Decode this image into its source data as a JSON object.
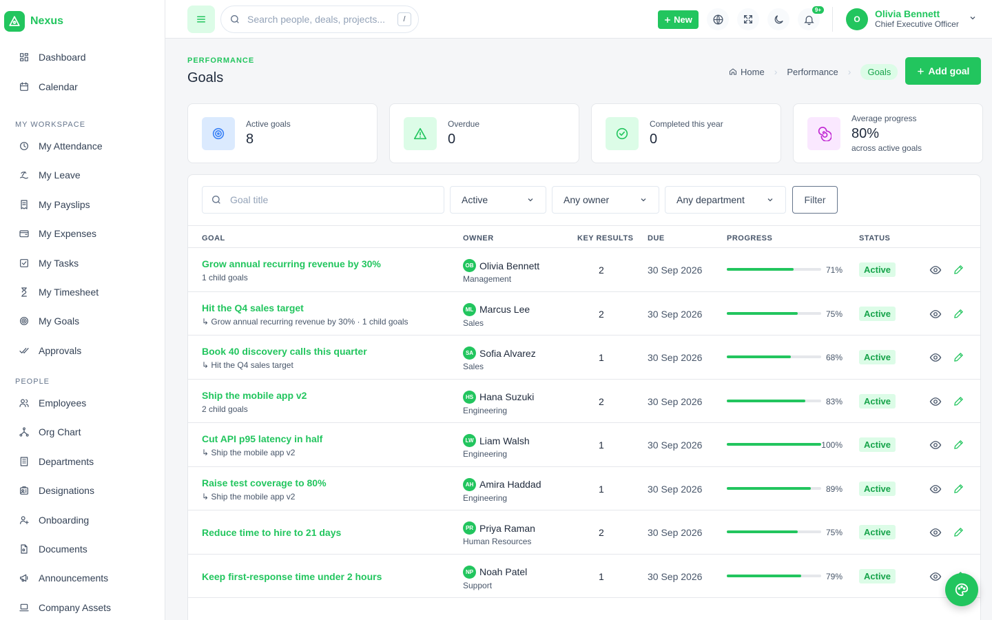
{
  "brand": {
    "name": "Nexus"
  },
  "sidebar": {
    "top": [
      {
        "label": "Dashboard",
        "icon": "dashboard-icon"
      },
      {
        "label": "Calendar",
        "icon": "calendar-icon"
      }
    ],
    "workspace_label": "MY WORKSPACE",
    "workspace": [
      {
        "label": "My Attendance",
        "icon": "clock-icon"
      },
      {
        "label": "My Leave",
        "icon": "beach-icon"
      },
      {
        "label": "My Payslips",
        "icon": "receipt-icon"
      },
      {
        "label": "My Expenses",
        "icon": "wallet-icon"
      },
      {
        "label": "My Tasks",
        "icon": "checkbox-icon"
      },
      {
        "label": "My Timesheet",
        "icon": "hourglass-icon"
      },
      {
        "label": "My Goals",
        "icon": "target-icon"
      },
      {
        "label": "Approvals",
        "icon": "double-check-icon"
      }
    ],
    "people_label": "PEOPLE",
    "people": [
      {
        "label": "Employees",
        "icon": "users-icon"
      },
      {
        "label": "Org Chart",
        "icon": "org-chart-icon"
      },
      {
        "label": "Departments",
        "icon": "building-icon"
      },
      {
        "label": "Designations",
        "icon": "id-badge-icon"
      },
      {
        "label": "Onboarding",
        "icon": "user-plus-icon"
      },
      {
        "label": "Documents",
        "icon": "document-icon"
      },
      {
        "label": "Announcements",
        "icon": "megaphone-icon"
      },
      {
        "label": "Company Assets",
        "icon": "laptop-icon"
      }
    ]
  },
  "topbar": {
    "search_placeholder": "Search people, deals, projects...",
    "search_shortcut": "/",
    "new_label": "New",
    "notif_badge": "9+",
    "user": {
      "initial": "O",
      "name": "Olivia Bennett",
      "role": "Chief Executive Officer"
    }
  },
  "page": {
    "eyebrow": "PERFORMANCE",
    "title": "Goals",
    "breadcrumb": [
      "Home",
      "Performance",
      "Goals"
    ],
    "add_label": "Add goal"
  },
  "stats": [
    {
      "label": "Active goals",
      "value": "8",
      "sub": "",
      "color": "#3b82f6",
      "bg": "#dbeafe",
      "icon": "target-icon"
    },
    {
      "label": "Overdue",
      "value": "0",
      "sub": "",
      "color": "#22c55e",
      "bg": "#dcfce7",
      "icon": "warning-icon"
    },
    {
      "label": "Completed this year",
      "value": "0",
      "sub": "",
      "color": "#22c55e",
      "bg": "#dcfce7",
      "icon": "check-circle-icon"
    },
    {
      "label": "Average progress",
      "value": "80%",
      "sub": "across active goals",
      "color": "#c026d3",
      "bg": "#fae8ff",
      "icon": "spiral-icon"
    }
  ],
  "filters": {
    "search_placeholder": "Goal title",
    "status": "Active",
    "owner": "Any owner",
    "department": "Any department",
    "button": "Filter"
  },
  "table": {
    "headers": {
      "goal": "GOAL",
      "owner": "OWNER",
      "key_results": "KEY RESULTS",
      "due": "DUE",
      "progress": "PROGRESS",
      "status": "STATUS"
    },
    "rows": [
      {
        "title": "Grow annual recurring revenue by 30%",
        "sub": "1 child goals",
        "owner_initials": "OB",
        "owner": "Olivia Bennett",
        "dept": "Management",
        "kr": "2",
        "due": "30 Sep 2026",
        "progress": 71,
        "pct": "71%",
        "status": "Active"
      },
      {
        "title": "Hit the Q4 sales target",
        "sub": "↳ Grow annual recurring revenue by 30% · 1 child goals",
        "owner_initials": "ML",
        "owner": "Marcus Lee",
        "dept": "Sales",
        "kr": "2",
        "due": "30 Sep 2026",
        "progress": 75,
        "pct": "75%",
        "status": "Active"
      },
      {
        "title": "Book 40 discovery calls this quarter",
        "sub": "↳ Hit the Q4 sales target",
        "owner_initials": "SA",
        "owner": "Sofia Alvarez",
        "dept": "Sales",
        "kr": "1",
        "due": "30 Sep 2026",
        "progress": 68,
        "pct": "68%",
        "status": "Active"
      },
      {
        "title": "Ship the mobile app v2",
        "sub": "2 child goals",
        "owner_initials": "HS",
        "owner": "Hana Suzuki",
        "dept": "Engineering",
        "kr": "2",
        "due": "30 Sep 2026",
        "progress": 83,
        "pct": "83%",
        "status": "Active"
      },
      {
        "title": "Cut API p95 latency in half",
        "sub": "↳ Ship the mobile app v2",
        "owner_initials": "LW",
        "owner": "Liam Walsh",
        "dept": "Engineering",
        "kr": "1",
        "due": "30 Sep 2026",
        "progress": 100,
        "pct": "100%",
        "status": "Active"
      },
      {
        "title": "Raise test coverage to 80%",
        "sub": "↳ Ship the mobile app v2",
        "owner_initials": "AH",
        "owner": "Amira Haddad",
        "dept": "Engineering",
        "kr": "1",
        "due": "30 Sep 2026",
        "progress": 89,
        "pct": "89%",
        "status": "Active"
      },
      {
        "title": "Reduce time to hire to 21 days",
        "sub": "",
        "owner_initials": "PR",
        "owner": "Priya Raman",
        "dept": "Human Resources",
        "kr": "2",
        "due": "30 Sep 2026",
        "progress": 75,
        "pct": "75%",
        "status": "Active"
      },
      {
        "title": "Keep first-response time under 2 hours",
        "sub": "",
        "owner_initials": "NP",
        "owner": "Noah Patel",
        "dept": "Support",
        "kr": "1",
        "due": "30 Sep 2026",
        "progress": 79,
        "pct": "79%",
        "status": "Active"
      }
    ]
  },
  "accent": "#22c55e"
}
